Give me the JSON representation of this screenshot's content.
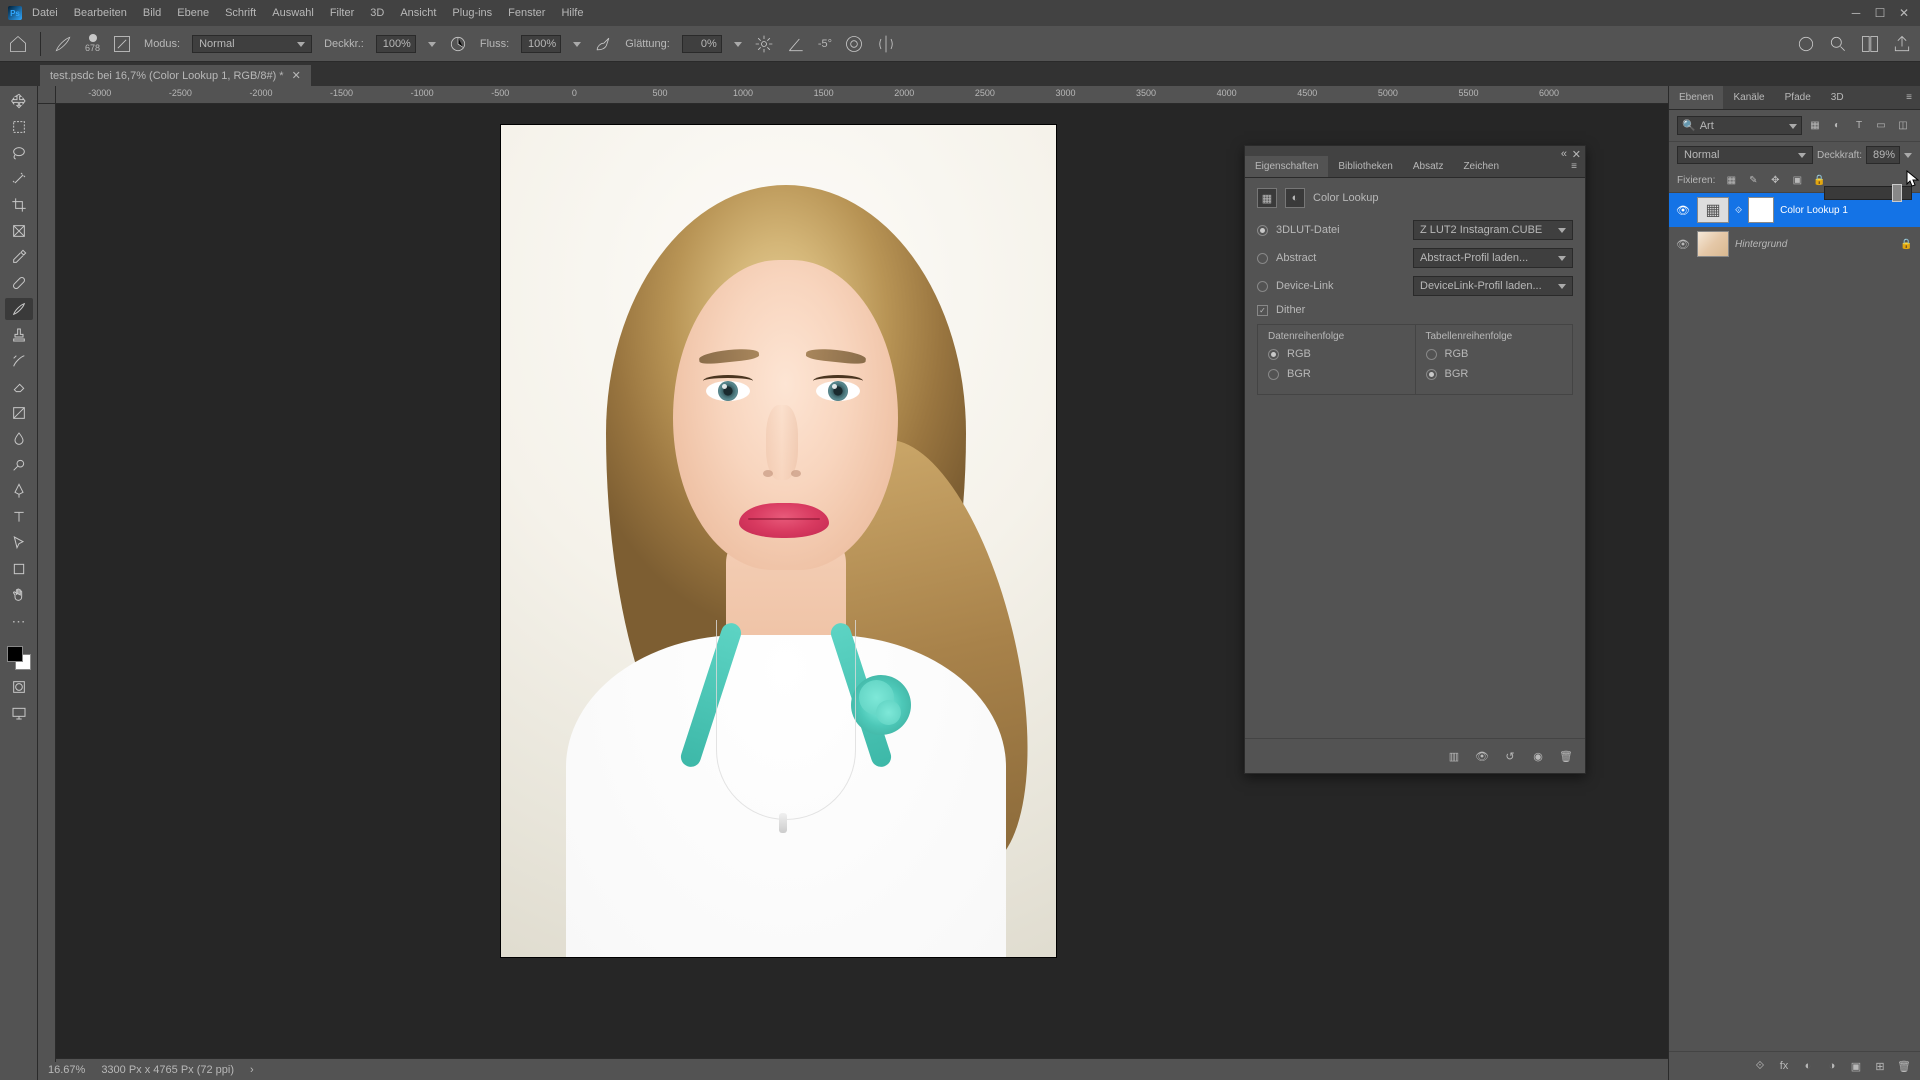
{
  "menu": {
    "datei": "Datei",
    "bearbeiten": "Bearbeiten",
    "bild": "Bild",
    "ebene": "Ebene",
    "schrift": "Schrift",
    "auswahl": "Auswahl",
    "filter": "Filter",
    "dreiD": "3D",
    "ansicht": "Ansicht",
    "plugins": "Plug-ins",
    "fenster": "Fenster",
    "hilfe": "Hilfe"
  },
  "optbar": {
    "brush_size": "678",
    "mode_label": "Modus:",
    "mode_value": "Normal",
    "opacity_label": "Deckkr.:",
    "opacity_value": "100%",
    "flow_label": "Fluss:",
    "flow_value": "100%",
    "smoothing_label": "Glättung:",
    "smoothing_value": "0%",
    "angle": "-5°"
  },
  "document": {
    "tab": "test.psdc bei 16,7% (Color Lookup 1, RGB/8#) *"
  },
  "ruler": {
    "t0": "-3000",
    "t1": "-2500",
    "t2": "-2000",
    "t3": "-1500",
    "t4": "-1000",
    "t5": "-500",
    "t6": "0",
    "t7": "500",
    "t8": "1000",
    "t9": "1500",
    "t10": "2000",
    "t11": "2500",
    "t12": "3000",
    "t13": "3500",
    "t14": "4000",
    "t15": "4500",
    "t16": "5000",
    "t17": "5500",
    "t18": "6000"
  },
  "status": {
    "zoom": "16.67%",
    "dims": "3300 Px x 4765 Px (72 ppi)"
  },
  "props": {
    "tabs": {
      "eigenschaften": "Eigenschaften",
      "bibliotheken": "Bibliotheken",
      "absatz": "Absatz",
      "zeichen": "Zeichen"
    },
    "title": "Color Lookup",
    "r1": {
      "label": "3DLUT-Datei",
      "value": "Z LUT2 Instagram.CUBE"
    },
    "r2": {
      "label": "Abstract",
      "value": "Abstract-Profil laden..."
    },
    "r3": {
      "label": "Device-Link",
      "value": "DeviceLink-Profil laden..."
    },
    "dither": "Dither",
    "col1": {
      "hdr": "Datenreihenfolge",
      "rgb": "RGB",
      "bgr": "BGR"
    },
    "col2": {
      "hdr": "Tabellenreihenfolge",
      "rgb": "RGB",
      "bgr": "BGR"
    }
  },
  "dock": {
    "tabs": {
      "ebenen": "Ebenen",
      "kanale": "Kanäle",
      "pfade": "Pfade",
      "dreiD": "3D"
    },
    "filter_label": "Art",
    "blend": "Normal",
    "opacity_label": "Deckkraft:",
    "opacity_value": "89%",
    "lock_label": "Fixieren:",
    "layers": {
      "l1": "Color Lookup 1",
      "l2": "Hintergrund"
    }
  }
}
